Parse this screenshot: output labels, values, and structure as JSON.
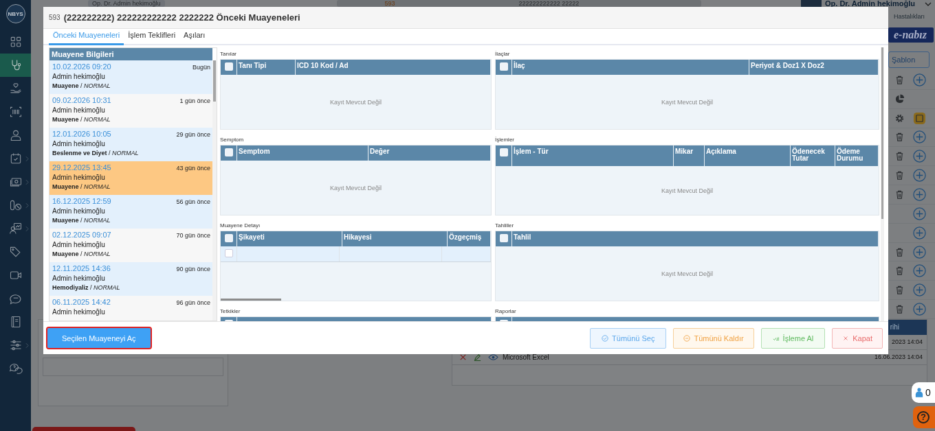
{
  "sidebar": {
    "logo": "NBYS",
    "items": [
      {
        "kind": "grid",
        "selected": false,
        "expandable": false
      },
      {
        "kind": "stethoscope",
        "selected": true,
        "expandable": false
      },
      {
        "kind": "hand-heart",
        "selected": false,
        "expandable": false
      },
      {
        "kind": "barcode",
        "selected": false,
        "expandable": false
      },
      {
        "kind": "doctor",
        "selected": false,
        "expandable": false
      },
      {
        "kind": "calendar",
        "selected": false,
        "expandable": true
      },
      {
        "kind": "money",
        "selected": false,
        "expandable": true
      },
      {
        "kind": "pills",
        "selected": false,
        "expandable": true
      },
      {
        "kind": "presentation",
        "selected": false,
        "expandable": true
      },
      {
        "kind": "tags",
        "selected": false,
        "expandable": false
      },
      {
        "kind": "video",
        "selected": false,
        "expandable": false
      },
      {
        "kind": "sms",
        "selected": false,
        "expandable": false
      },
      {
        "kind": "book",
        "selected": false,
        "expandable": false
      },
      {
        "kind": "sliders",
        "selected": false,
        "expandable": true
      },
      {
        "kind": "chat-help",
        "selected": false,
        "expandable": false
      }
    ]
  },
  "background": {
    "doctor_pill": "Op. Dr. Admin hekimoğlu",
    "patient_number": "593",
    "patient_name": "222222222222 22222",
    "user": {
      "name": "Op. Dr. Admin hekimoğlu",
      "department": "Hastalıkları"
    },
    "logo": "e-nabız",
    "template_dropdown": "Şablon",
    "rail": [
      {
        "kind": "trash-plus"
      },
      {
        "kind": "pie"
      },
      {
        "kind": "gear-save"
      },
      {
        "kind": "trash-plus"
      },
      {
        "kind": "trash-plus"
      },
      {
        "kind": "trash-plus"
      },
      {
        "kind": "trash-plus"
      },
      {
        "kind": "plus"
      },
      {
        "kind": "plus"
      },
      {
        "kind": "trash-plus"
      },
      {
        "kind": "trash-plus"
      },
      {
        "kind": "trash-plus"
      },
      {
        "kind": "trash-plus"
      }
    ],
    "files": {
      "header": "rihi",
      "rows": [
        {
          "date": "2023 14:04"
        },
        {
          "file": "Microsoft Excel",
          "date": "16.06.2023 14:04"
        }
      ]
    },
    "counter": "0",
    "help": "?"
  },
  "modal": {
    "number": "593",
    "title": "(222222222) 222222222222 2222222 Önceki Muayeneleri",
    "tabs": [
      {
        "label": "Önceki Muayeneleri",
        "selected": true
      },
      {
        "label": "İşlem Teklifleri",
        "selected": false
      },
      {
        "label": "Aşıları",
        "selected": false
      }
    ],
    "list_header": "Muayene Bilgileri",
    "visits": [
      {
        "date": "10.02.2026 09:20",
        "ago": "Bugün",
        "doctor": "Admin hekimoğlu",
        "summary": "**Muayene** / *NORMAL*",
        "selected": false
      },
      {
        "date": "09.02.2026 10:31",
        "ago": "1 gün önce",
        "doctor": "Admin hekimoğlu",
        "summary": "**Muayene** / *NORMAL*",
        "selected": false
      },
      {
        "date": "12.01.2026 10:05",
        "ago": "29 gün önce",
        "doctor": "Admin hekimoğlu",
        "summary": "**Beslenme ve Diyet** / *NORMAL*",
        "selected": false
      },
      {
        "date": "29.12.2025 13:45",
        "ago": "43 gün önce",
        "doctor": "Admin hekimoğlu",
        "summary": "**Muayene** / *NORMAL*",
        "selected": true
      },
      {
        "date": "16.12.2025 12:59",
        "ago": "56 gün önce",
        "doctor": "Admin hekimoğlu",
        "summary": "**Muayene** / *NORMAL*",
        "selected": false
      },
      {
        "date": "02.12.2025 09:07",
        "ago": "70 gün önce",
        "doctor": "Admin hekimoğlu",
        "summary": "**Muayene** / *NORMAL*",
        "selected": false
      },
      {
        "date": "12.11.2025 14:36",
        "ago": "90 gün önce",
        "doctor": "Admin hekimoğlu",
        "summary": "**Hemodiyaliz** / *NORMAL*",
        "selected": false
      },
      {
        "date": "06.11.2025 14:42",
        "ago": "96 gün önce",
        "doctor": "Admin hekimoğlu",
        "selected": false
      }
    ],
    "panels": [
      {
        "title": "Tanılar",
        "select_all_checked": false,
        "columns": [
          "Tanı Tipi",
          "ICD 10 Kod / Ad"
        ],
        "empty_text": "Kayıt Mevcut Değil"
      },
      {
        "title": "İlaçlar",
        "select_all_checked": false,
        "columns": [
          "İlaç",
          "Periyot & Doz1 X Doz2"
        ],
        "empty_text": "Kayıt Mevcut Değil"
      },
      {
        "title": "Semptom",
        "select_all_checked": false,
        "columns": [
          "Semptom",
          "Değer"
        ],
        "empty_text": "Kayıt Mevcut Değil"
      },
      {
        "title": "İşlemler",
        "select_all_checked": false,
        "columns": [
          "İşlem - Tür",
          "Mikar",
          "Açıklama",
          "Ödenecek Tutar",
          "Ödeme Durumu"
        ],
        "empty_text": "Kayıt Mevcut Değil"
      },
      {
        "title": "Muayene Detayı",
        "select_all_checked": false,
        "columns": [
          "Şikayeti",
          "Hikayesi",
          "Özgeçmiş"
        ],
        "rows": [
          {
            "checked": false
          }
        ]
      },
      {
        "title": "Tahliller",
        "select_all_checked": false,
        "columns": [
          "Tahlil"
        ],
        "empty_text": "Kayıt Mevcut Değil"
      },
      {
        "title": "Tetkikler",
        "select_all_checked": false
      },
      {
        "title": "Raporlar",
        "select_all_checked": false
      }
    ],
    "buttons": [
      {
        "label": "Seçilen Muayeneyi Aç",
        "kind": "primary",
        "focused": true
      },
      {
        "label": "Tümünü Seç",
        "kind": "info",
        "focused": false
      },
      {
        "label": "Tümünü Kaldır",
        "kind": "warning",
        "focused": false
      },
      {
        "label": "İşleme Al",
        "kind": "success",
        "focused": false
      },
      {
        "label": "Kapat",
        "kind": "danger",
        "focused": false
      }
    ]
  }
}
